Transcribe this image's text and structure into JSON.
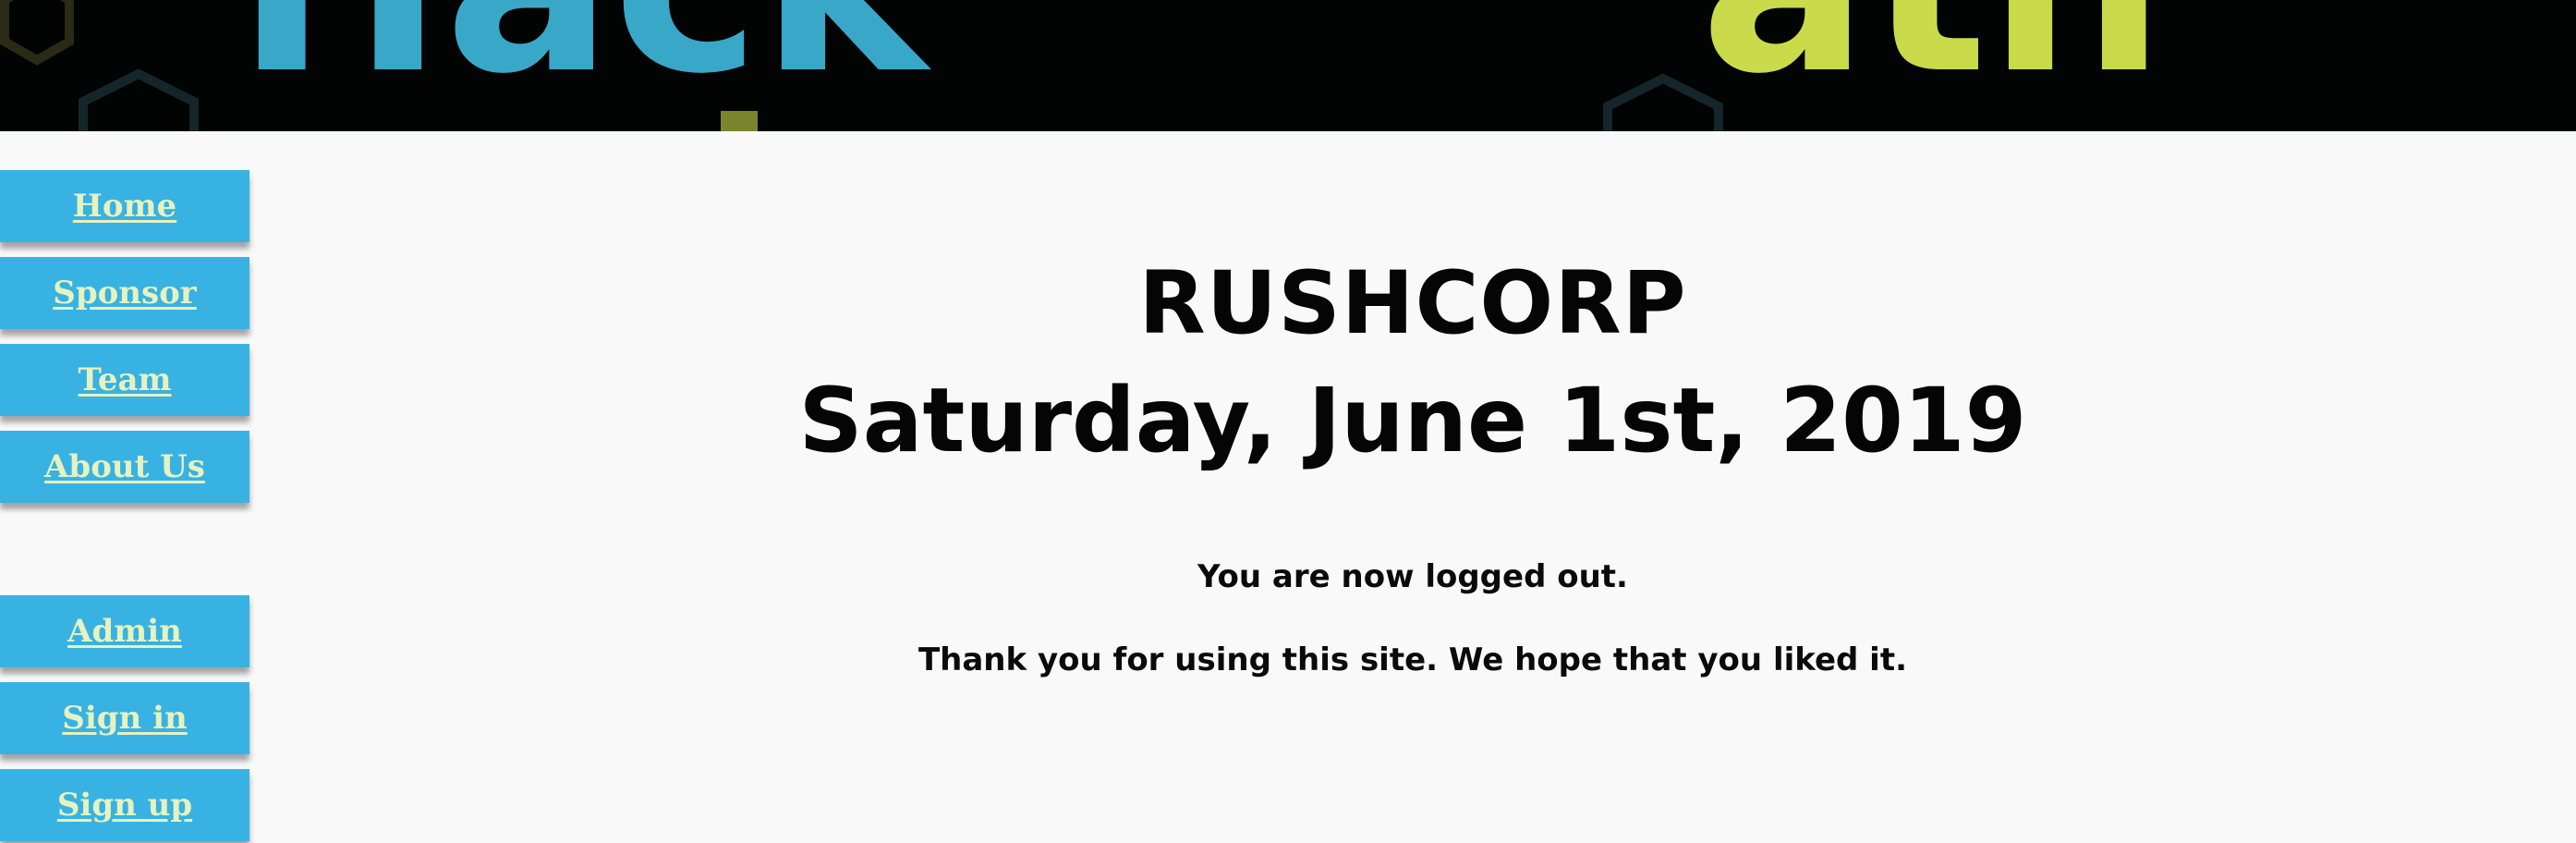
{
  "banner": {
    "logo_text_left": "Hack",
    "logo_text_right": "ath",
    "colors": {
      "background": "#020303",
      "left": "#39a8c8",
      "right": "#c9db4a"
    }
  },
  "sidebar": {
    "items": [
      {
        "label": "Home"
      },
      {
        "label": "Sponsor"
      },
      {
        "label": "Team"
      },
      {
        "label": "About Us"
      },
      {
        "label": "Admin"
      },
      {
        "label": "Sign in"
      },
      {
        "label": "Sign up"
      }
    ],
    "colors": {
      "button": "#38b2e2",
      "text": "#e6f2bf"
    }
  },
  "main": {
    "company": "RUSHCORP",
    "date": "Saturday, June 1st, 2019",
    "logout_message": "You are now logged out.",
    "thanks_message": "Thank you for using this site. We hope that you liked it."
  }
}
